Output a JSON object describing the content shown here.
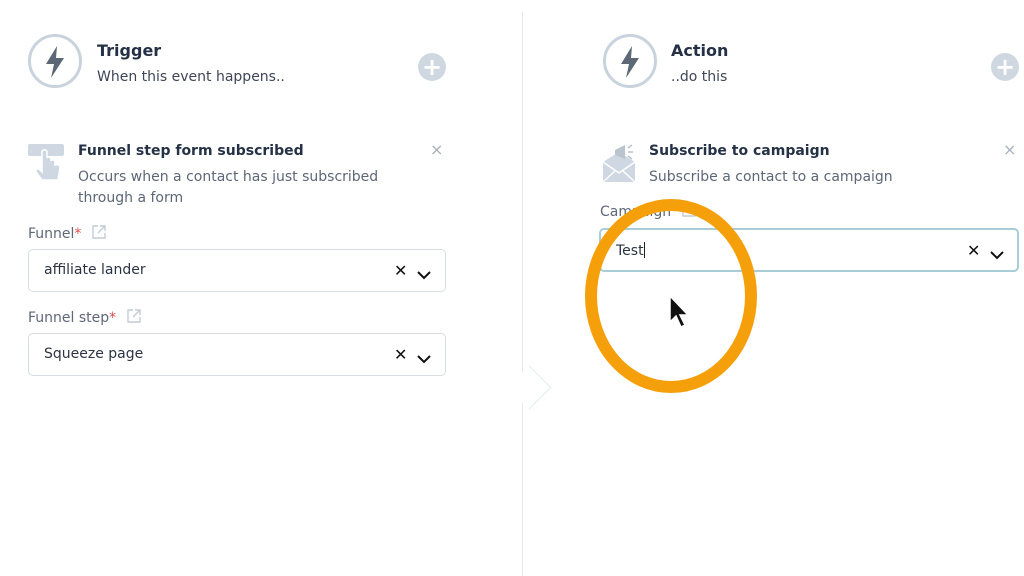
{
  "trigger": {
    "title": "Trigger",
    "subtitle": "When this event happens..",
    "card": {
      "title": "Funnel step form subscribed",
      "description": "Occurs when a contact has just subscribed through a form"
    },
    "fields": [
      {
        "label": "Funnel",
        "required_mark": "*",
        "value": "affiliate lander"
      },
      {
        "label": "Funnel step",
        "required_mark": "*",
        "value": "Squeeze page"
      }
    ]
  },
  "action": {
    "title": "Action",
    "subtitle": "..do this",
    "card": {
      "title": "Subscribe to campaign",
      "description": "Subscribe a contact to a campaign"
    },
    "field": {
      "label": "Campaign",
      "input_value": "Test"
    }
  },
  "glyphs": {
    "close": "×",
    "clear": "✕",
    "plus": "+"
  },
  "colors": {
    "highlight": "#f5a00a",
    "muted": "#c9d3dd",
    "focus_border": "#a9cdd6"
  },
  "icons": [
    "lightning-bolt-icon",
    "plus-icon",
    "hand-pointer-icon",
    "envelope-megaphone-icon",
    "external-link-icon",
    "close-icon",
    "clear-icon",
    "chevron-down-icon",
    "mouse-cursor-icon"
  ]
}
